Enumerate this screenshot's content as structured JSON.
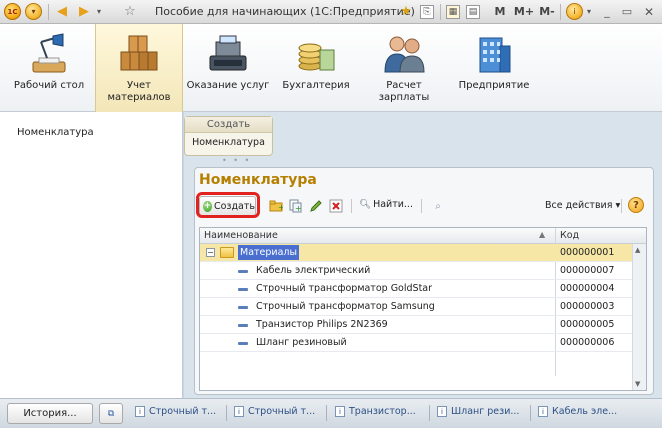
{
  "window": {
    "title": "Пособие для начинающих  (1С:Предприятие)",
    "logo_text": "1С",
    "mem_buttons": [
      "M",
      "M+",
      "M-"
    ]
  },
  "sections": [
    {
      "label": "Рабочий стол",
      "icon": "desk-lamp-icon"
    },
    {
      "label": "Учет материалов",
      "icon": "boxes-icon"
    },
    {
      "label": "Оказание услуг",
      "icon": "cash-register-icon"
    },
    {
      "label": "Бухгалтерия",
      "icon": "coins-icon"
    },
    {
      "label": "Расчет зарплаты",
      "icon": "people-icon"
    },
    {
      "label": "Предприятие",
      "icon": "building-icon"
    }
  ],
  "navigation": {
    "items": [
      "Номенклатура"
    ]
  },
  "action_panel": {
    "header": "Создать",
    "items": [
      "Номенклатура"
    ]
  },
  "form": {
    "title": "Номенклатура",
    "create_label": "Создать",
    "find_label": "Найти...",
    "all_actions_label": "Все действия ▾",
    "help_label": "?"
  },
  "table": {
    "columns": [
      "Наименование",
      "Код"
    ],
    "rows": [
      {
        "name": "Материалы",
        "code": "000000001",
        "type": "folder",
        "selected": true
      },
      {
        "name": "Кабель электрический",
        "code": "000000007",
        "type": "item"
      },
      {
        "name": "Строчный трансформатор GoldStar",
        "code": "000000004",
        "type": "item"
      },
      {
        "name": "Строчный трансформатор Samsung",
        "code": "000000003",
        "type": "item"
      },
      {
        "name": "Транзистор Philips 2N2369",
        "code": "000000005",
        "type": "item"
      },
      {
        "name": "Шланг резиновый",
        "code": "000000006",
        "type": "item"
      }
    ]
  },
  "taskbar": {
    "history_label": "История...",
    "items": [
      "Строчный т...",
      "Строчный т...",
      "Транзистор...",
      "Шланг рези...",
      "Кабель эле..."
    ]
  },
  "colors": {
    "accent_title": "#b57f00",
    "highlight": "#e2221f",
    "selected_row": "#f7e7a6"
  }
}
